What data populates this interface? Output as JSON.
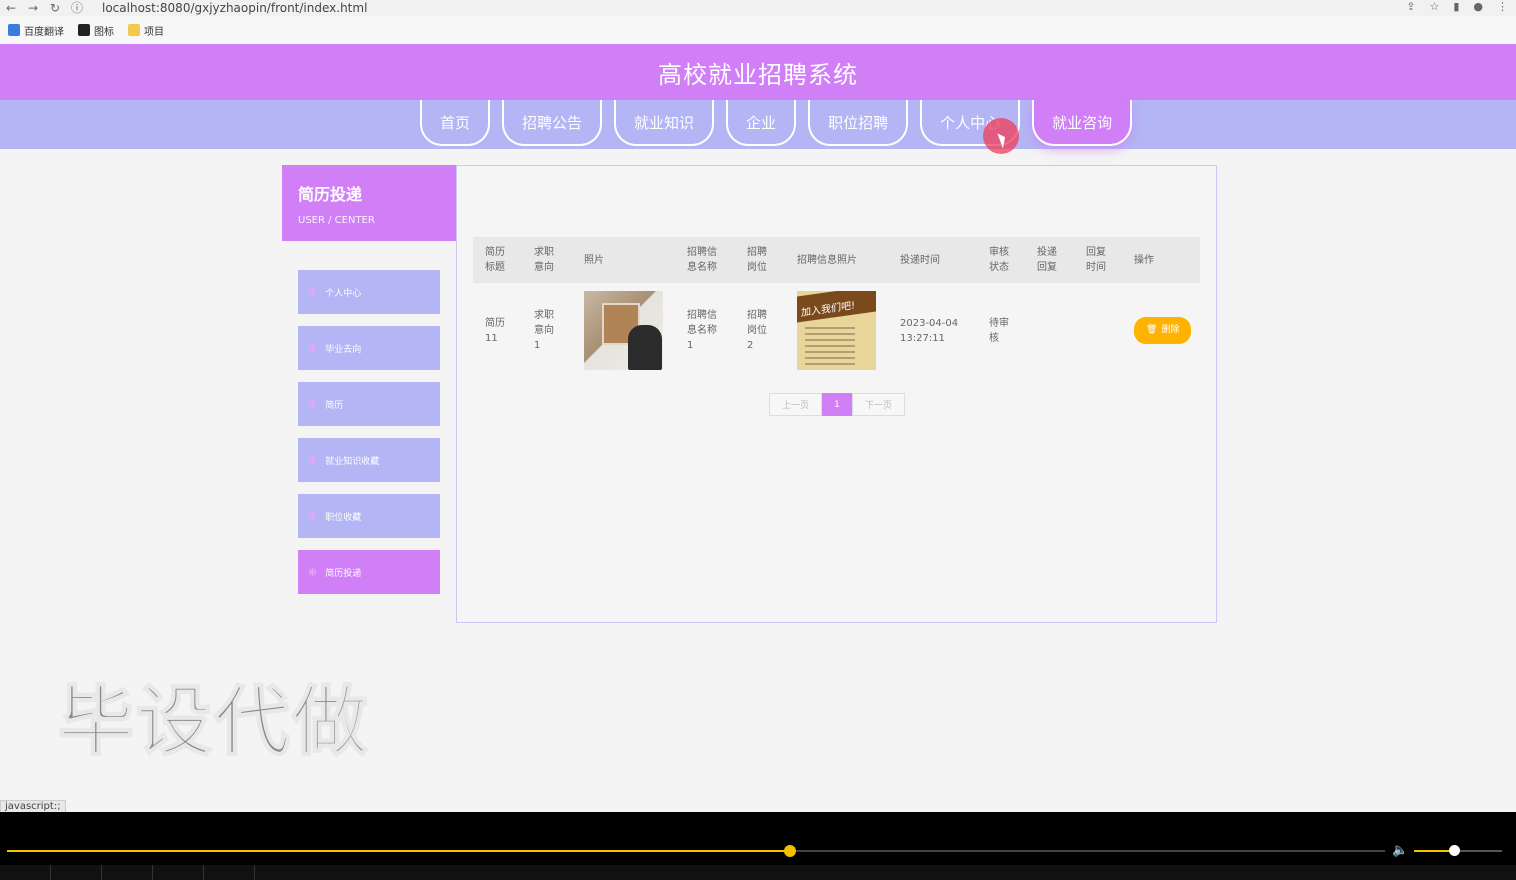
{
  "browser": {
    "url": "localhost:8080/gxjyzhaopin/front/index.html",
    "bookmarks": [
      {
        "label": "百度翻译",
        "icon": "translate-icon",
        "color": "#3a7be0"
      },
      {
        "label": "图标",
        "icon": "image-icon",
        "color": "#222222"
      },
      {
        "label": "项目",
        "icon": "folder-icon",
        "color": "#f2c94c"
      }
    ]
  },
  "site": {
    "title": "高校就业招聘系统",
    "nav": [
      "首页",
      "招聘公告",
      "就业知识",
      "企业",
      "职位招聘",
      "个人中心",
      "就业咨询"
    ],
    "active_nav": 6
  },
  "sidebar": {
    "title": "简历投递",
    "subtitle": "USER / CENTER",
    "items": [
      "个人中心",
      "毕业去向",
      "简历",
      "就业知识收藏",
      "职位收藏",
      "简历投递"
    ],
    "active_item": 5
  },
  "table": {
    "headers": [
      "简历\n标题",
      "求职\n意向",
      "照片",
      "招聘信\n息名称",
      "招聘\n岗位",
      "招聘信息照片",
      "投递时间",
      "审核\n状态",
      "投递\n回复",
      "回复\n时间",
      "操作"
    ],
    "rows": [
      {
        "resume_title": "简历\n11",
        "intention": "求职\n意向\n1",
        "info_name": "招聘信\n息名称\n1",
        "position": "招聘\n岗位\n2",
        "poster_text": "加入我们吧!",
        "time": "2023-04-04\n13:27:11",
        "status": "待审\n核",
        "reply": "",
        "reply_time": "",
        "action": "删除"
      }
    ]
  },
  "pager": {
    "prev": "上一页",
    "current": "1",
    "next": "下一页"
  },
  "watermark": "毕设代做",
  "status_bar": "javascript:;",
  "player": {
    "progress": 0.568,
    "volume": 0.45
  },
  "colors": {
    "primary": "#d07ff6",
    "nav": "#b3b5f4",
    "delete": "#ffb300"
  }
}
